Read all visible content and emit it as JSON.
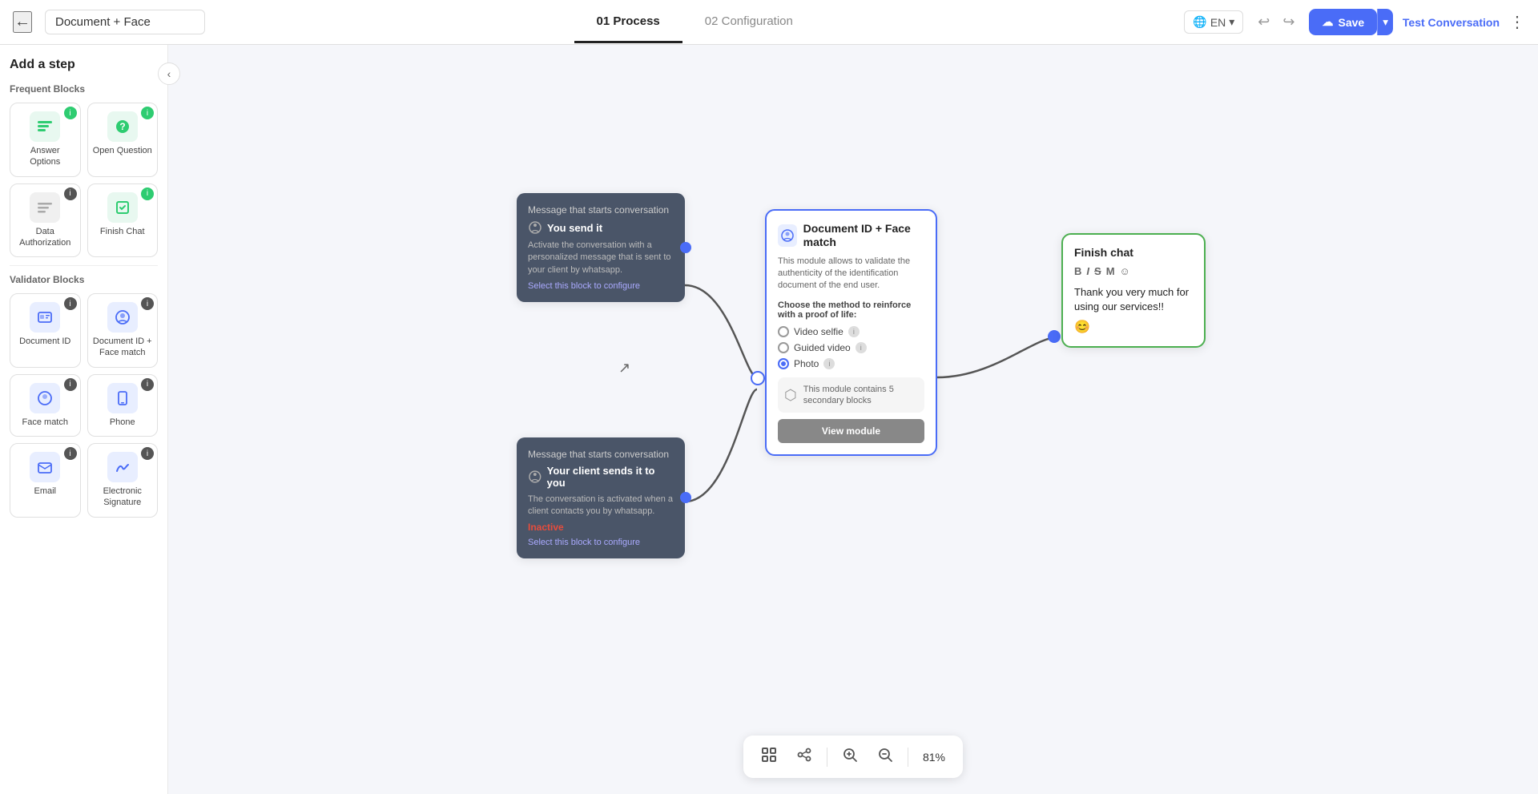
{
  "header": {
    "back_label": "←",
    "title_value": "Document + Face",
    "tabs": [
      {
        "id": "process",
        "label": "01 Process",
        "active": true
      },
      {
        "id": "config",
        "label": "02 Configuration",
        "active": false
      }
    ],
    "lang": "EN",
    "undo_label": "↩",
    "redo_label": "↪",
    "save_label": "Save",
    "save_dropdown_label": "▾",
    "test_conv_label": "Test Conversation",
    "more_label": "⋮"
  },
  "sidebar": {
    "title": "Add a step",
    "frequent_label": "Frequent Blocks",
    "frequent_blocks": [
      {
        "id": "answer-options",
        "label": "Answer Options",
        "icon": "≡",
        "icon_type": "green",
        "badge": "i"
      },
      {
        "id": "open-question",
        "label": "Open Question",
        "icon": "?",
        "icon_type": "green",
        "badge": "i"
      },
      {
        "id": "data-auth",
        "label": "Data Authorization",
        "icon": "≡",
        "icon_type": "gray",
        "badge": "i"
      },
      {
        "id": "finish-chat",
        "label": "Finish Chat",
        "icon": "🔒",
        "icon_type": "green",
        "badge": "i"
      }
    ],
    "validator_label": "Validator Blocks",
    "validator_blocks": [
      {
        "id": "document-id",
        "label": "Document ID",
        "icon": "🪪",
        "icon_type": "blue",
        "badge": "i"
      },
      {
        "id": "doc-face",
        "label": "Document ID + Face match",
        "icon": "🔊",
        "icon_type": "blue",
        "badge": "i"
      },
      {
        "id": "face-match",
        "label": "Face match",
        "icon": "👁",
        "icon_type": "blue",
        "badge": "i"
      },
      {
        "id": "phone",
        "label": "Phone",
        "icon": "📱",
        "icon_type": "blue",
        "badge": "i"
      },
      {
        "id": "email",
        "label": "Email",
        "icon": "@",
        "icon_type": "blue",
        "badge": "i"
      },
      {
        "id": "electronic-sig",
        "label": "Electronic Signature",
        "icon": "✍",
        "icon_type": "blue",
        "badge": "i"
      }
    ]
  },
  "nodes": {
    "msg_start_1": {
      "title": "Message that starts conversation",
      "sender": "You send it",
      "desc": "Activate the conversation with a personalized message that is sent to your client by whatsapp.",
      "link": "Select this block to configure"
    },
    "msg_start_2": {
      "title": "Message that starts conversation",
      "sender": "Your client sends it to you",
      "desc": "The conversation is activated when a client contacts you by whatsapp.",
      "inactive": "Inactive",
      "link": "Select this block to configure"
    },
    "doc_face": {
      "title": "Document ID + Face match",
      "desc": "This module allows to validate the authenticity of the identification document of the end user.",
      "subtitle": "Choose the method to reinforce with a proof of life:",
      "options": [
        {
          "id": "video-selfie",
          "label": "Video selfie",
          "checked": false
        },
        {
          "id": "guided-video",
          "label": "Guided video",
          "checked": false
        },
        {
          "id": "photo",
          "label": "Photo",
          "checked": true
        }
      ],
      "secondary_count": "5",
      "secondary_text": "This module contains 5 secondary blocks",
      "view_module": "View module"
    },
    "finish_chat": {
      "title": "Finish chat",
      "message": "Thank you very much for using our services!!",
      "emoji": "😊",
      "format_btns": [
        "B",
        "I",
        "S",
        "M",
        "☺"
      ]
    }
  },
  "toolbar": {
    "focus_icon": "⊡",
    "share_icon": "⬡",
    "zoom_in_icon": "+",
    "zoom_out_icon": "−",
    "zoom_pct": "81%"
  }
}
